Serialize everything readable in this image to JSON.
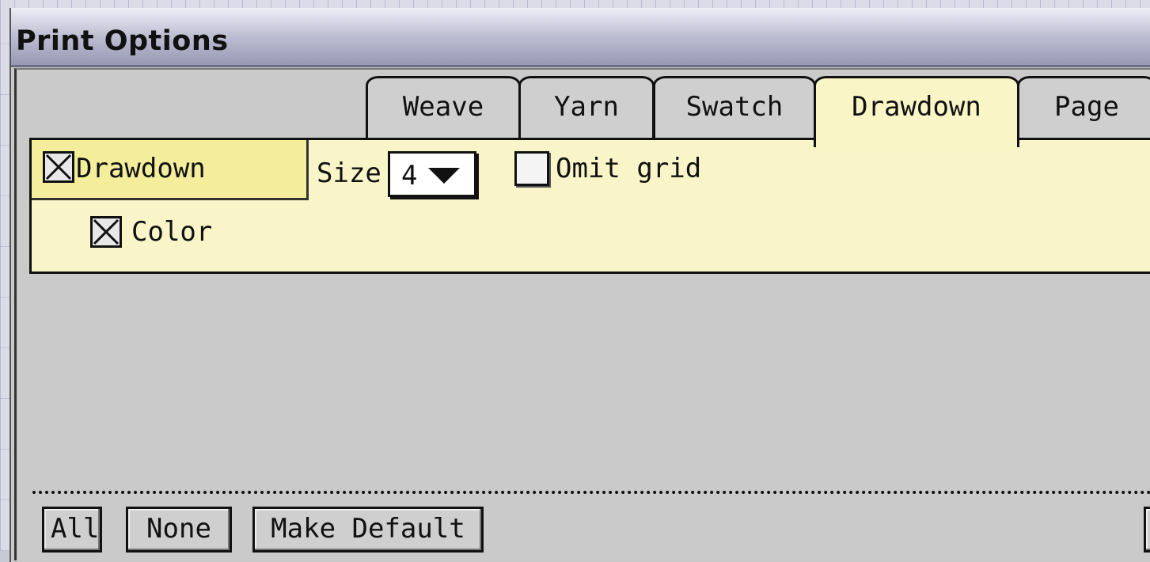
{
  "window": {
    "title": "Print Options"
  },
  "tabs": [
    {
      "label": "Weave",
      "active": false
    },
    {
      "label": "Yarn",
      "active": false
    },
    {
      "label": "Swatch",
      "active": false
    },
    {
      "label": "Drawdown",
      "active": true
    },
    {
      "label": "Page",
      "active": false
    }
  ],
  "drawdown": {
    "section_label": "Drawdown",
    "section_checked": true,
    "size_label": "Size",
    "size_value": "4",
    "omit_grid_label": "Omit grid",
    "omit_grid_checked": false,
    "color_label": "Color",
    "color_checked": true
  },
  "buttons": {
    "all": "All",
    "none": "None",
    "make_default": "Make Default"
  },
  "colors": {
    "panel_bg": "#f9f5c8",
    "section_bg": "#f4ee9c",
    "window_bg": "#cacaca"
  }
}
